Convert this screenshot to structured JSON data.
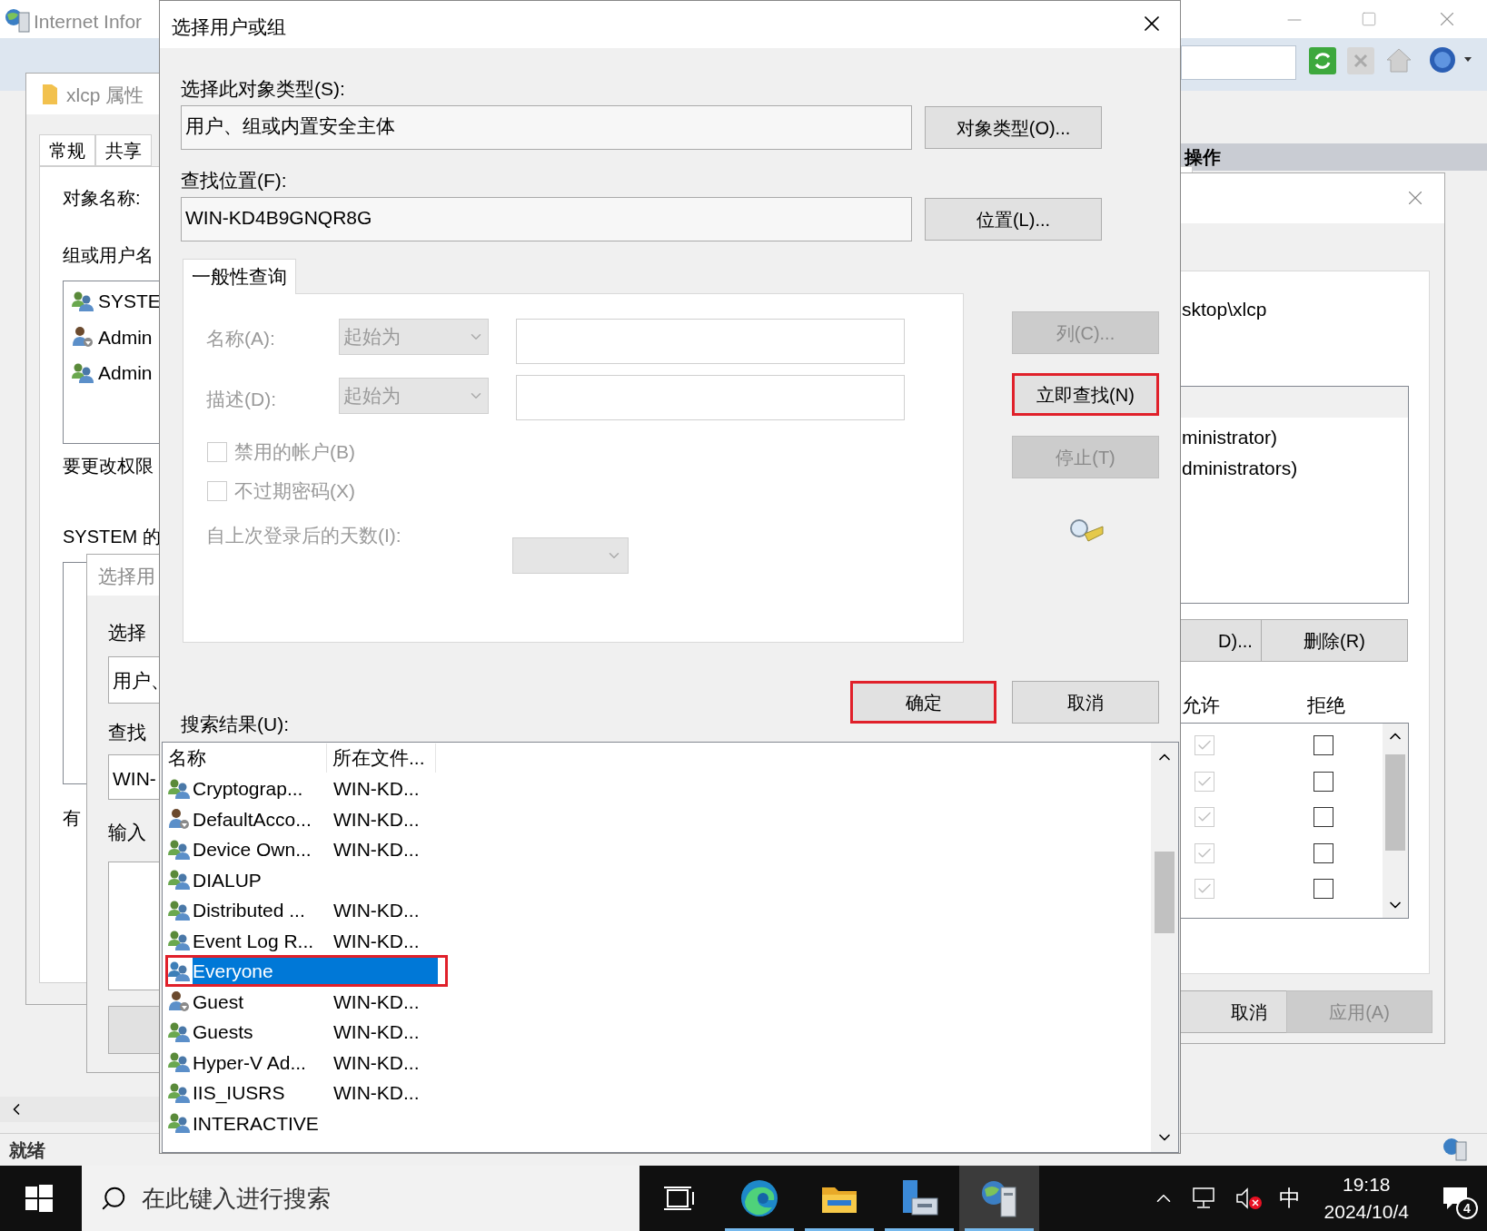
{
  "background_window": {
    "title": "Internet Infor",
    "actions_header": "操作",
    "status": "就绪"
  },
  "properties_window": {
    "title": "xlcp 属性",
    "tabs": [
      "常规",
      "共享"
    ],
    "object_label": "对象名称:",
    "groups_label": "组或用户名",
    "groups": [
      {
        "name": "SYSTE",
        "kind": "group"
      },
      {
        "name": "Admin",
        "kind": "user"
      },
      {
        "name": "Admin",
        "kind": "group"
      }
    ],
    "change_hint": "要更改权限",
    "permissions_label": "SYSTEM 的",
    "more_hint": "有"
  },
  "permissions_dialog": {
    "object_name": "sktop\\xlcp",
    "groups": [
      "ministrator)",
      "dministrators)"
    ],
    "add_button": "D)...",
    "remove_button": "删除(R)",
    "allow_header": "允许",
    "deny_header": "拒绝",
    "permissions": [
      {
        "allow": true,
        "deny": false
      },
      {
        "allow": true,
        "deny": false
      },
      {
        "allow": true,
        "deny": false
      },
      {
        "allow": true,
        "deny": false
      },
      {
        "allow": true,
        "deny": false
      }
    ],
    "cancel_button": "取消",
    "apply_button": {
      "label": "应用(A)",
      "disabled": true
    }
  },
  "back_dialog": {
    "title": "选择用",
    "type_label": "选择",
    "type_value": "用户、",
    "location_label": "查找",
    "location_value": "WIN-",
    "input_label": "输入"
  },
  "dialog": {
    "title": "选择用户或组",
    "object_type_label": "选择此对象类型(S):",
    "object_type_value": "用户、组或内置安全主体",
    "object_types_button": "对象类型(O)...",
    "location_label": "查找位置(F):",
    "location_value": "WIN-KD4B9GNQR8G",
    "location_button": "位置(L)...",
    "tab": "一般性查询",
    "query": {
      "disabled": true,
      "name_label": "名称(A):",
      "name_match": "起始为",
      "desc_label": "描述(D):",
      "desc_match": "起始为",
      "checkboxes": [
        {
          "label": "禁用的帐户(B)",
          "checked": false
        },
        {
          "label": "不过期密码(X)",
          "checked": false
        }
      ],
      "days_label": "自上次登录后的天数(I):"
    },
    "side_buttons": [
      {
        "label": "列(C)...",
        "disabled": true,
        "highlighted": false
      },
      {
        "label": "立即查找(N)",
        "disabled": false,
        "highlighted": true
      },
      {
        "label": "停止(T)",
        "disabled": true,
        "highlighted": false
      }
    ],
    "ok_button": {
      "label": "确定",
      "highlighted": true
    },
    "cancel_button": "取消",
    "results_label": "搜索结果(U):",
    "columns": [
      "名称",
      "所在文件..."
    ],
    "rows": [
      {
        "name": "Cryptograp...",
        "folder": "WIN-KD...",
        "kind": "group",
        "selected": false,
        "highlighted": false
      },
      {
        "name": "DefaultAcco...",
        "folder": "WIN-KD...",
        "kind": "user",
        "selected": false,
        "highlighted": false
      },
      {
        "name": "Device Own...",
        "folder": "WIN-KD...",
        "kind": "group",
        "selected": false,
        "highlighted": false
      },
      {
        "name": "DIALUP",
        "kind": "group",
        "selected": false,
        "highlighted": false
      },
      {
        "name": "Distributed ...",
        "folder": "WIN-KD...",
        "kind": "group",
        "selected": false,
        "highlighted": false
      },
      {
        "name": "Event Log R...",
        "folder": "WIN-KD...",
        "kind": "group",
        "selected": false,
        "highlighted": false
      },
      {
        "name": "Everyone",
        "kind": "group",
        "selected": true,
        "highlighted": true
      },
      {
        "name": "Guest",
        "folder": "WIN-KD...",
        "kind": "user",
        "selected": false,
        "highlighted": false
      },
      {
        "name": "Guests",
        "folder": "WIN-KD...",
        "kind": "group",
        "selected": false,
        "highlighted": false
      },
      {
        "name": "Hyper-V Ad...",
        "folder": "WIN-KD...",
        "kind": "group",
        "selected": false,
        "highlighted": false
      },
      {
        "name": "IIS_IUSRS",
        "folder": "WIN-KD...",
        "kind": "group",
        "selected": false,
        "highlighted": false
      },
      {
        "name": "INTERACTIVE",
        "kind": "group",
        "selected": false,
        "highlighted": false
      }
    ]
  },
  "taskbar": {
    "search_placeholder": "在此键入进行搜索",
    "apps": [
      {
        "kind": "taskview",
        "open": false,
        "selected": false
      },
      {
        "kind": "edge",
        "open": true,
        "selected": false
      },
      {
        "kind": "explorer",
        "open": true,
        "selected": false
      },
      {
        "kind": "server",
        "open": true,
        "selected": false
      },
      {
        "kind": "iis",
        "open": true,
        "selected": true
      }
    ],
    "ime": "中",
    "time": "19:18",
    "date": "2024/10/4",
    "notifications": "4"
  }
}
